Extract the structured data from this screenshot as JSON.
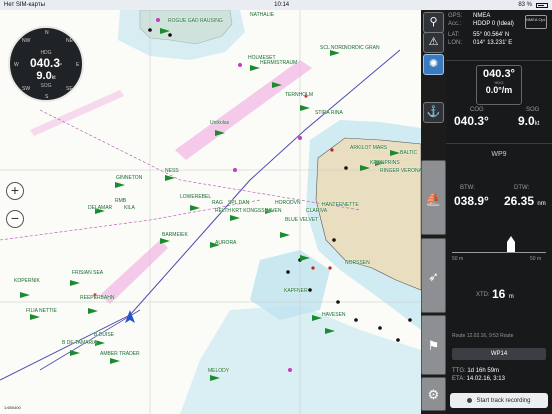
{
  "status_bar": {
    "carrier": "Нет SIM-карты",
    "time": "10:14",
    "battery": "83 %"
  },
  "compass": {
    "hdg_label": "HDG",
    "hdg_value": "040.3",
    "hdg_unit": "°",
    "sog_value": "9.0",
    "sog_unit": "kt",
    "sog_label": "SOG",
    "cardinals": [
      "N",
      "NE",
      "E",
      "SE",
      "S",
      "SW",
      "W",
      "NW"
    ]
  },
  "map": {
    "zoom_in": "+",
    "zoom_out": "−",
    "scale_text": "1:650400",
    "ships": [
      "ROGUE GAD RAUSING",
      "NATHALIE",
      "SCL NORD",
      "NORDIC GRAN",
      "HERMISTRAUM",
      "HOLMESET",
      "TERNHOLM",
      "STIRA RINA",
      "Unikolas",
      "NESS",
      "ARKILOT MARS",
      "BALTIC",
      "KRONPRINS",
      "RINGER VERONA",
      "GINNETON",
      "HORODVN",
      "CLARIVA",
      "HANTEENETTE",
      "DELAMAR",
      "RMB",
      "KILA",
      "LOWEREBEL",
      "RAG",
      "SPL DAN",
      "RELTH",
      "KRT KONGSSHAVEN",
      "BLUE VELVET",
      "BARMEIEK",
      "AURORA",
      "NORSSEN",
      "FRISIAN SEA",
      "KOPERNIK",
      "REEPERBAHN",
      "FILIA NETTIE",
      "B DUISE",
      "B DE TAMARIA",
      "AMBER TRADER",
      "MELODY",
      "KAPFNER",
      "HAVESEN"
    ]
  },
  "toolbar": {
    "route_icon": "route-icon",
    "sail_icon": "sailboat-icon",
    "warn_icon": "warning-icon",
    "anchor_icon": "anchor-icon"
  },
  "gps": {
    "gps_label": "GPS:",
    "gps_value": "NMEA",
    "acc_label": "Acc.:",
    "acc_value": "HDOP 0 (Ideal)",
    "lat_label": "LAT:",
    "lat_value": "55° 00.564' N",
    "lon_label": "LON:",
    "lon_value": "014° 13.231' E",
    "nmea_button": "NMEA Opt."
  },
  "heading_panel": {
    "hdg_value": "040.3°",
    "hdg_label": "HDG",
    "rot_value": "0.0°/m"
  },
  "cog_sog": {
    "cog_label": "COG",
    "cog_value": "040.3°",
    "sog_label": "SOG",
    "sog_value": "9.0",
    "sog_unit": "kt"
  },
  "waypoint": {
    "title": "WP9",
    "btw_label": "BTW:",
    "btw_value": "038.9°",
    "dtw_label": "DTW:",
    "dtw_value": "26.35",
    "dtw_unit": "nm",
    "xte_left": "50 m",
    "xte_right": "50 m",
    "xtd_label": "XTD:",
    "xtd_value": "16",
    "xtd_unit": "m",
    "route_label": "Route 12.02.16, 9:53 Route",
    "next_wp": "WP14",
    "ttg_label": "TTG:",
    "ttg_value": "1d 16h 59m",
    "eta_label": "ETA:",
    "eta_value": "14.02.16, 3:13"
  },
  "track_button": "Start track recording"
}
